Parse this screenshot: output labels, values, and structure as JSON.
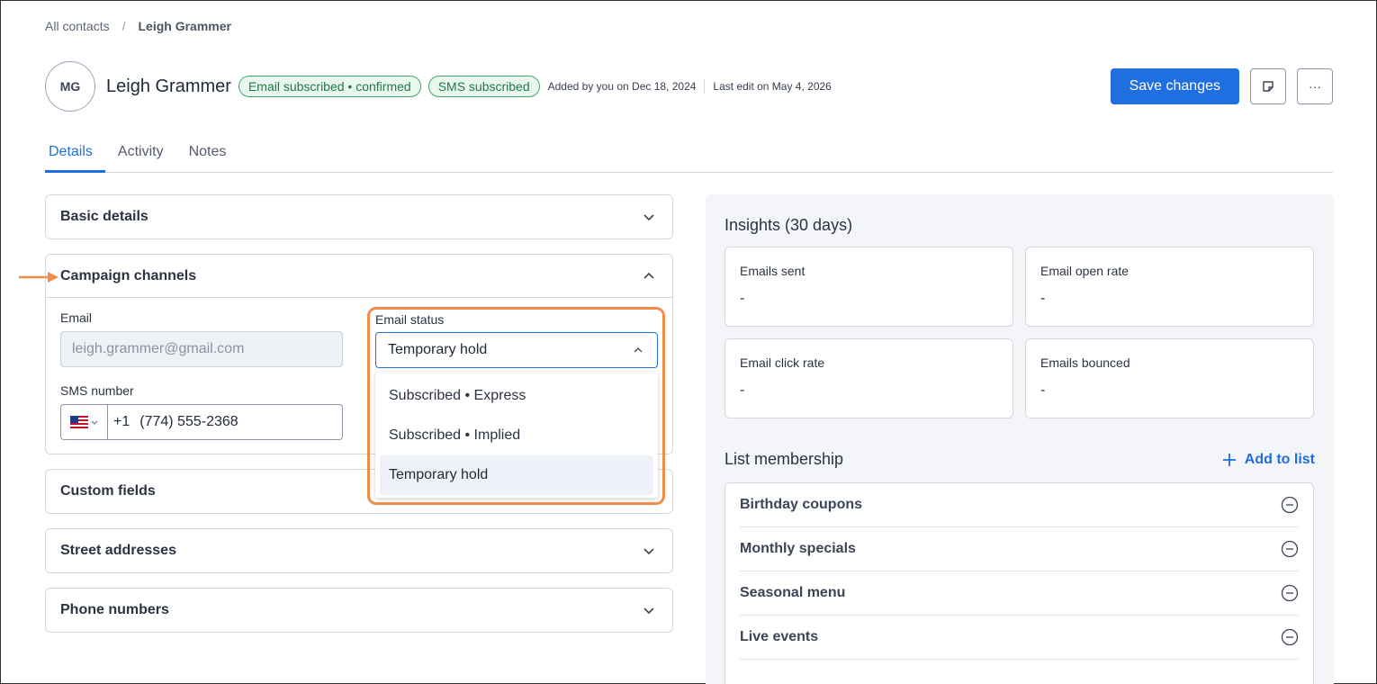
{
  "breadcrumb": {
    "root": "All contacts",
    "separator": "/",
    "current": "Leigh Grammer"
  },
  "contact": {
    "initials": "MG",
    "name": "Leigh Grammer",
    "badges": [
      "Email subscribed • confirmed",
      "SMS subscribed"
    ],
    "added": "Added by you on Dec 18, 2024",
    "last_edit": "Last edit on May 4, 2026"
  },
  "actions": {
    "save_label": "Save changes",
    "note_icon": "sticky-note-icon",
    "more_label": "···"
  },
  "tabs": [
    {
      "label": "Details",
      "active": true
    },
    {
      "label": "Activity",
      "active": false
    },
    {
      "label": "Notes",
      "active": false
    }
  ],
  "sections": {
    "basic": "Basic details",
    "campaign": "Campaign channels",
    "custom": "Custom fields",
    "street": "Street addresses",
    "phones": "Phone numbers"
  },
  "campaign": {
    "email_label": "Email",
    "email_value": "leigh.grammer@gmail.com",
    "sms_label": "SMS number",
    "sms_code": "+1",
    "sms_number": "(774) 555-2368",
    "status_label": "Email status",
    "status_value": "Temporary hold",
    "status_options": [
      "Subscribed • Express",
      "Subscribed • Implied",
      "Temporary hold"
    ]
  },
  "insights": {
    "title": "Insights (30 days)",
    "stats": [
      {
        "label": "Emails sent",
        "value": "-"
      },
      {
        "label": "Email open rate",
        "value": "-"
      },
      {
        "label": "Email click rate",
        "value": "-"
      },
      {
        "label": "Emails bounced",
        "value": "-"
      }
    ]
  },
  "lists": {
    "title": "List membership",
    "add_label": "Add to list",
    "items": [
      "Birthday coupons",
      "Monthly specials",
      "Seasonal menu",
      "Live events"
    ]
  },
  "colors": {
    "accent": "#1f6fe0",
    "highlight": "#f28c4b",
    "badge_green": "#1f7a46"
  }
}
